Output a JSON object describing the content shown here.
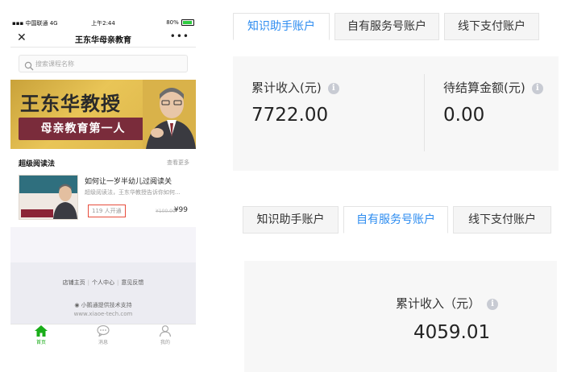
{
  "phone": {
    "status_bar": {
      "carrier": "中国联通",
      "network": "4G",
      "time": "上午2:44",
      "battery": "80%",
      "battery_level": 0.8
    },
    "nav": {
      "close_icon": "close-icon",
      "title": "王东华母亲教育",
      "more_icon": "more-icon"
    },
    "search": {
      "placeholder": "搜索课程名称"
    },
    "banner": {
      "title": "王东华教授",
      "subtitle": "母亲教育第一人"
    },
    "section": {
      "title": "超级阅读法",
      "more": "查看更多"
    },
    "course": {
      "title": "如何让一岁半幼儿过阅读关",
      "desc": "超级阅读法，王东华教授告诉你如何...",
      "count": "119 人开通",
      "old_price": "¥100.00",
      "price": "¥99"
    },
    "footer": {
      "links": [
        "店铺主页",
        "个人中心",
        "意见反馈"
      ],
      "support": "小鹅通提供技术支持",
      "url": "www.xiaoe-tech.com"
    },
    "tabbar": [
      {
        "label": "首页",
        "icon": "home-icon"
      },
      {
        "label": "消息",
        "icon": "message-icon"
      },
      {
        "label": "我的",
        "icon": "user-icon"
      }
    ]
  },
  "panel_top": {
    "tabs": [
      "知识助手账户",
      "自有服务号账户",
      "线下支付账户"
    ],
    "active_tab": 0,
    "stats": [
      {
        "label": "累计收入(元)",
        "value": "7722.00"
      },
      {
        "label": "待结算金额(元)",
        "value": "0.00"
      }
    ]
  },
  "panel_bottom": {
    "tabs": [
      "知识助手账户",
      "自有服务号账户",
      "线下支付账户"
    ],
    "active_tab": 1,
    "stats": [
      {
        "label": "累计收入（元）",
        "value": "4059.01"
      }
    ]
  },
  "colors": {
    "accent_blue": "#2d8cf0",
    "wechat_green": "#1aad19",
    "highlight_red": "#e74c3c"
  }
}
